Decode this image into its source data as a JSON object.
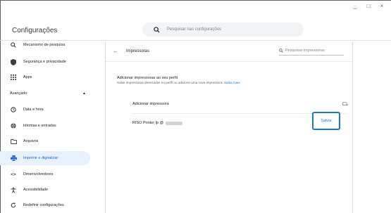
{
  "window": {
    "minimize": "_",
    "maximize": "□",
    "close": "×"
  },
  "header": {
    "title": "Configurações",
    "search_placeholder": "Pesquisar nas configurações"
  },
  "sidebar": {
    "items_top": [
      {
        "label": "Mecanismo de pesquisa",
        "icon": "search-icon"
      },
      {
        "label": "Segurança e privacidade",
        "icon": "shield-icon"
      },
      {
        "label": "Apps",
        "icon": "apps-grid-icon"
      }
    ],
    "advanced_label": "Avançado",
    "advanced_toggle": "▲",
    "items_advanced": [
      {
        "label": "Data e hora",
        "icon": "clock-icon"
      },
      {
        "label": "Idiomas e entradas",
        "icon": "globe-icon"
      },
      {
        "label": "Arquivos",
        "icon": "folder-icon"
      },
      {
        "label": "Imprimir e digitalizar",
        "icon": "printer-icon",
        "active": true
      },
      {
        "label": "Desenvolvedores",
        "icon": "code-icon"
      },
      {
        "label": "Acessibilidade",
        "icon": "accessibility-icon"
      },
      {
        "label": "Redefinir configurações",
        "icon": "reset-icon"
      }
    ]
  },
  "main": {
    "back_label": "←",
    "page_title": "Impressoras",
    "search_placeholder": "Pesquisar impressoras",
    "section_title": "Adicionar impressoras ao seu perfil",
    "section_desc": "Salve impressoras detectadas no perfil ou adicione uma nova impressora.",
    "learn_more": "Saiba mais",
    "add_printer_label": "Adicionar impressora",
    "printer_name": "RISO Printer lp @",
    "save_label": "Salvar"
  },
  "colors": {
    "accent": "#1a73e8",
    "active_bg": "#e8f0fe"
  }
}
